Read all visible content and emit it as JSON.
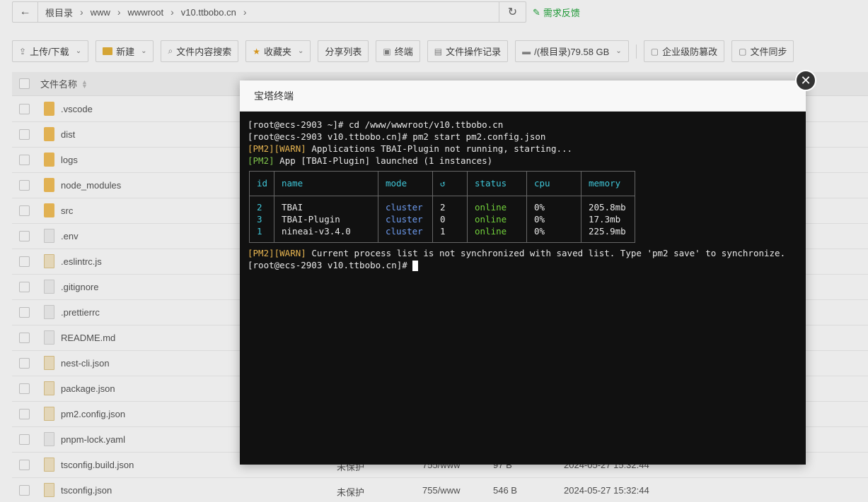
{
  "pathbar": {
    "crumbs": [
      "根目录",
      "www",
      "wwwroot",
      "v10.ttbobo.cn"
    ],
    "feedback": "需求反馈"
  },
  "toolbar": {
    "upload": "上传/下载",
    "new": "新建",
    "search_content": "文件内容搜索",
    "favorites": "收藏夹",
    "share_list": "分享列表",
    "terminal": "终端",
    "op_log": "文件操作记录",
    "disk": "/(根目录)79.58 GB",
    "tamper": "企业级防篡改",
    "sync": "文件同步"
  },
  "file_list": {
    "header_name": "文件名称",
    "rows": [
      {
        "name": ".vscode",
        "type": "folder"
      },
      {
        "name": "dist",
        "type": "folder"
      },
      {
        "name": "logs",
        "type": "folder"
      },
      {
        "name": "node_modules",
        "type": "folder"
      },
      {
        "name": "src",
        "type": "folder"
      },
      {
        "name": ".env",
        "type": "doc"
      },
      {
        "name": ".eslintrc.js",
        "type": "code"
      },
      {
        "name": ".gitignore",
        "type": "doc"
      },
      {
        "name": ".prettierrc",
        "type": "doc"
      },
      {
        "name": "README.md",
        "type": "doc"
      },
      {
        "name": "nest-cli.json",
        "type": "code"
      },
      {
        "name": "package.json",
        "type": "code"
      },
      {
        "name": "pm2.config.json",
        "type": "code"
      },
      {
        "name": "pnpm-lock.yaml",
        "type": "doc"
      },
      {
        "name": "tsconfig.build.json",
        "type": "code",
        "perm": "未保护",
        "owner": "755/www",
        "size": "97 B",
        "date": "2024-05-27 15:32:44"
      },
      {
        "name": "tsconfig.json",
        "type": "code",
        "perm": "未保护",
        "owner": "755/www",
        "size": "546 B",
        "date": "2024-05-27 15:32:44"
      }
    ]
  },
  "dialog": {
    "title": "宝塔终端",
    "close_label": "✕"
  },
  "terminal": {
    "line1": "[root@ecs-2903 ~]# cd /www/wwwroot/v10.ttbobo.cn",
    "line2": "[root@ecs-2903 v10.ttbobo.cn]# pm2 start pm2.config.json",
    "line3_tag": "[PM2][WARN]",
    "line3_text": " Applications TBAI-Plugin not running, starting...",
    "line4_tag": "[PM2]",
    "line4_text": " App [TBAI-Plugin] launched (1 instances)",
    "table": {
      "headers": {
        "id": "id",
        "name": "name",
        "mode": "mode",
        "restart": "↺",
        "status": "status",
        "cpu": "cpu",
        "memory": "memory"
      },
      "rows": [
        {
          "id": "2",
          "name": "TBAI",
          "mode": "cluster",
          "restart": "2",
          "status": "online",
          "cpu": "0%",
          "memory": "205.8mb"
        },
        {
          "id": "3",
          "name": "TBAI-Plugin",
          "mode": "cluster",
          "restart": "0",
          "status": "online",
          "cpu": "0%",
          "memory": "17.3mb"
        },
        {
          "id": "1",
          "name": "nineai-v3.4.0",
          "mode": "cluster",
          "restart": "1",
          "status": "online",
          "cpu": "0%",
          "memory": "225.9mb"
        }
      ]
    },
    "warn_tag": "[PM2][WARN]",
    "warn_text": " Current process list is not synchronized with saved list. Type 'pm2 save' to synchronize.",
    "prompt": "[root@ecs-2903 v10.ttbobo.cn]# "
  }
}
